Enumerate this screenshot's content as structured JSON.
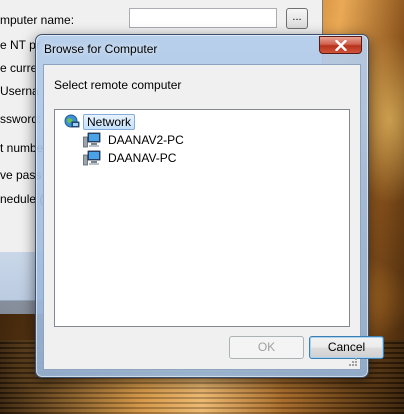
{
  "background_window": {
    "labels": [
      "mputer name:",
      "e NT pr",
      "e curre",
      " Userna",
      "ssword:",
      "t numbe",
      "ve pass",
      "nedule ("
    ],
    "browse_label": "..."
  },
  "dialog": {
    "title": "Browse for Computer",
    "prompt": "Select remote computer",
    "tree": {
      "root": {
        "label": "Network",
        "icon": "network-icon"
      },
      "children": [
        {
          "label": "DAANAV2-PC",
          "icon": "computer-icon"
        },
        {
          "label": "DAANAV-PC",
          "icon": "computer-icon"
        }
      ]
    },
    "ok_label": "OK",
    "cancel_label": "Cancel"
  },
  "colors": {
    "close_button": "#c7432a",
    "selection": "#c4e0fa"
  }
}
